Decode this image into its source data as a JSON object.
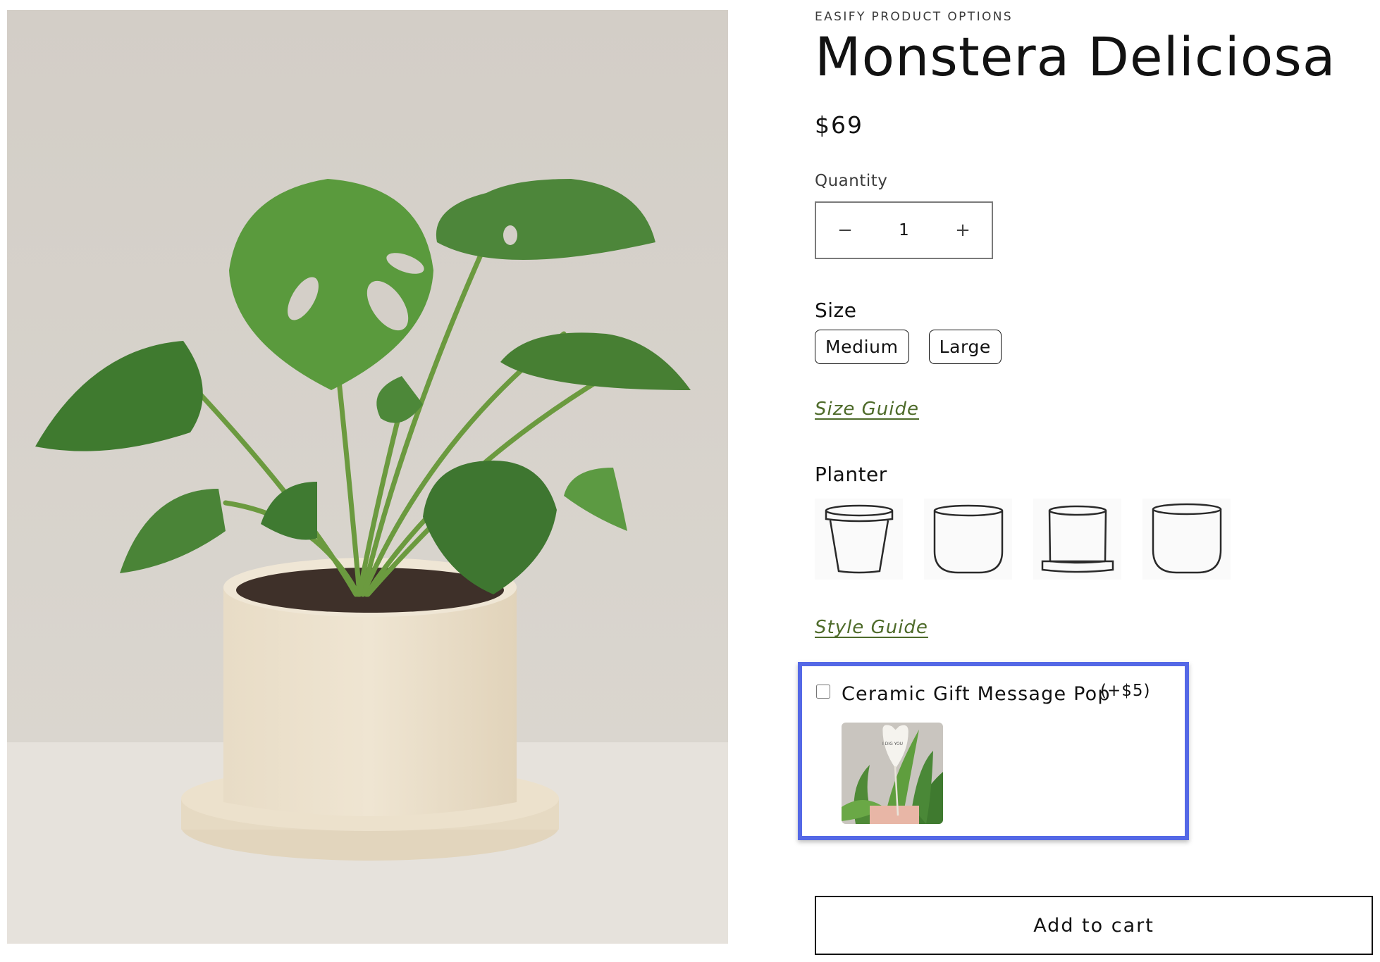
{
  "product": {
    "vendor": "EASIFY PRODUCT OPTIONS",
    "title": "Monstera Deliciosa",
    "price": "$69",
    "image_icon": "monstera-plant-photo"
  },
  "quantity": {
    "label": "Quantity",
    "value": "1",
    "decrease_symbol": "−",
    "increase_symbol": "+"
  },
  "size": {
    "label": "Size",
    "options": [
      "Medium",
      "Large"
    ],
    "guide_link": "Size Guide"
  },
  "planter": {
    "label": "Planter",
    "options": [
      "tapered-pot-icon",
      "rounded-pot-icon",
      "pot-with-saucer-icon",
      "rounded-pot-icon"
    ],
    "guide_link": "Style Guide"
  },
  "addon": {
    "label": "Ceramic Gift Message Pop",
    "price": "(+$5)",
    "checked": false,
    "highlight_color": "#5468e6",
    "thumbnail_text": "I DIG YOU"
  },
  "cart": {
    "button_label": "Add to cart"
  },
  "colors": {
    "link": "#4e6b2a",
    "text": "#121212"
  }
}
